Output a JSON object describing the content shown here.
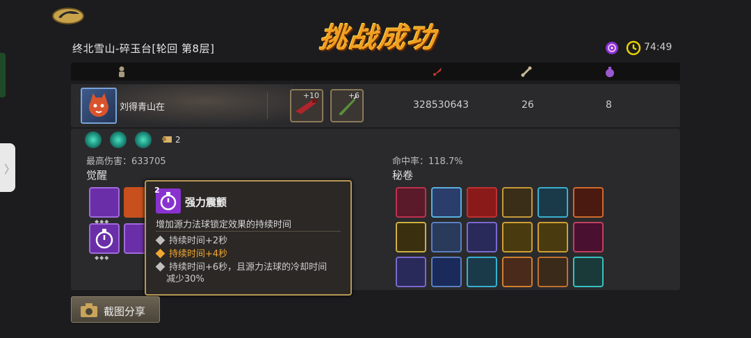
{
  "stage": {
    "title": "终北雪山-碎玉台[轮回 第8层]",
    "result": "挑战成功"
  },
  "timer": {
    "value": "74:49"
  },
  "header": {
    "icons": [
      "player-icon",
      "damage-icon",
      "bone-icon",
      "potion-icon"
    ]
  },
  "player": {
    "name": "刘得青山在",
    "weapons": [
      {
        "level": "+10",
        "icon": "red-cannon-icon"
      },
      {
        "level": "+6",
        "icon": "green-dagger-icon"
      }
    ],
    "damage": "328530643",
    "count_a": "26",
    "count_b": "8"
  },
  "detail": {
    "scroll_count": "2",
    "max_damage": "最高伤害：633705",
    "hit_rate": "命中率：118.7%",
    "awaken_label": "觉醒",
    "secret_label": "秘卷"
  },
  "tooltip": {
    "badge": "2",
    "title": "强力震颤",
    "description": "增加源力法球锁定效果的持续时间",
    "tiers": [
      {
        "text": "持续时间+2秒",
        "active": false
      },
      {
        "text": "持续时间+4秒",
        "active": true
      },
      {
        "text": "持续时间+6秒，且源力法球的冷却时间",
        "text2": "减少30%",
        "active": false
      }
    ]
  },
  "share": {
    "label": "截图分享"
  },
  "colors": {
    "accent": "#f0a020",
    "gold_border": "#b89a55",
    "active_tier": "#f0a630",
    "purple": "#8a32d0"
  }
}
